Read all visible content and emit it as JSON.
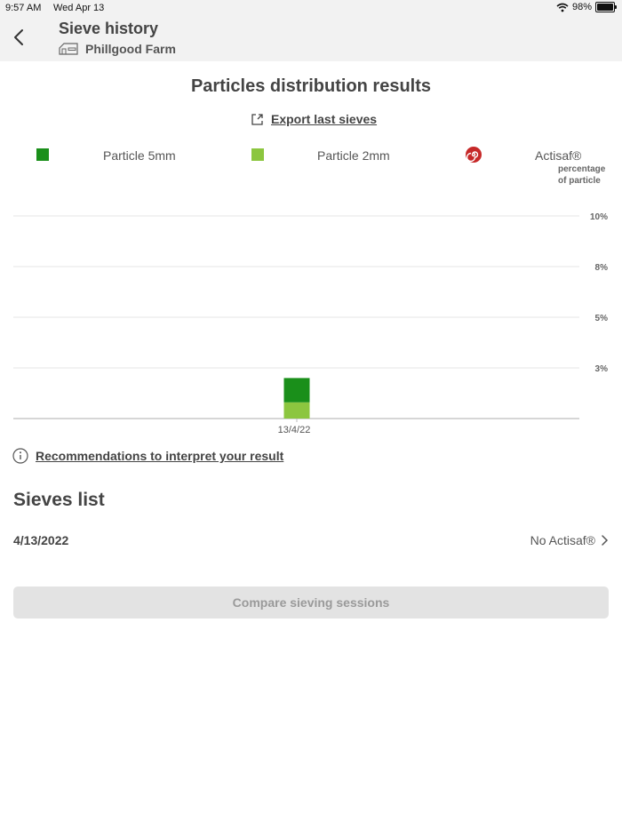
{
  "status_bar": {
    "time": "9:57 AM",
    "date": "Wed Apr 13",
    "battery": "98%"
  },
  "header": {
    "title": "Sieve history",
    "farm": "Phillgood Farm"
  },
  "results": {
    "title": "Particles distribution results",
    "export_label": "Export last sieves"
  },
  "legend": {
    "particle_5mm": "Particle 5mm",
    "particle_2mm": "Particle 2mm",
    "actisaf": "Actisaf®",
    "axis_unit_line1": "percentage",
    "axis_unit_line2": "of particle"
  },
  "colors": {
    "particle_5mm": "#1a8f1a",
    "particle_2mm": "#8cc63f",
    "actisaf": "#c62828",
    "grid": "#e6e6e6"
  },
  "chart_data": {
    "type": "bar",
    "stacked": true,
    "categories": [
      "13/4/22"
    ],
    "series": [
      {
        "name": "Particle 2mm",
        "values": [
          0.8
        ]
      },
      {
        "name": "Particle 5mm",
        "values": [
          1.2
        ]
      }
    ],
    "ytick_labels": [
      "3%",
      "5%",
      "8%",
      "10%"
    ],
    "ytick_values": [
      2.5,
      5,
      7.5,
      10
    ],
    "ylim": [
      0,
      10
    ],
    "grid": true,
    "y_axis_position": "right"
  },
  "recommendations_label": "Recommendations to interpret your result",
  "sieves": {
    "title": "Sieves list",
    "items": [
      {
        "date": "4/13/2022",
        "status": "No Actisaf®"
      }
    ]
  },
  "compare_label": "Compare sieving sessions"
}
